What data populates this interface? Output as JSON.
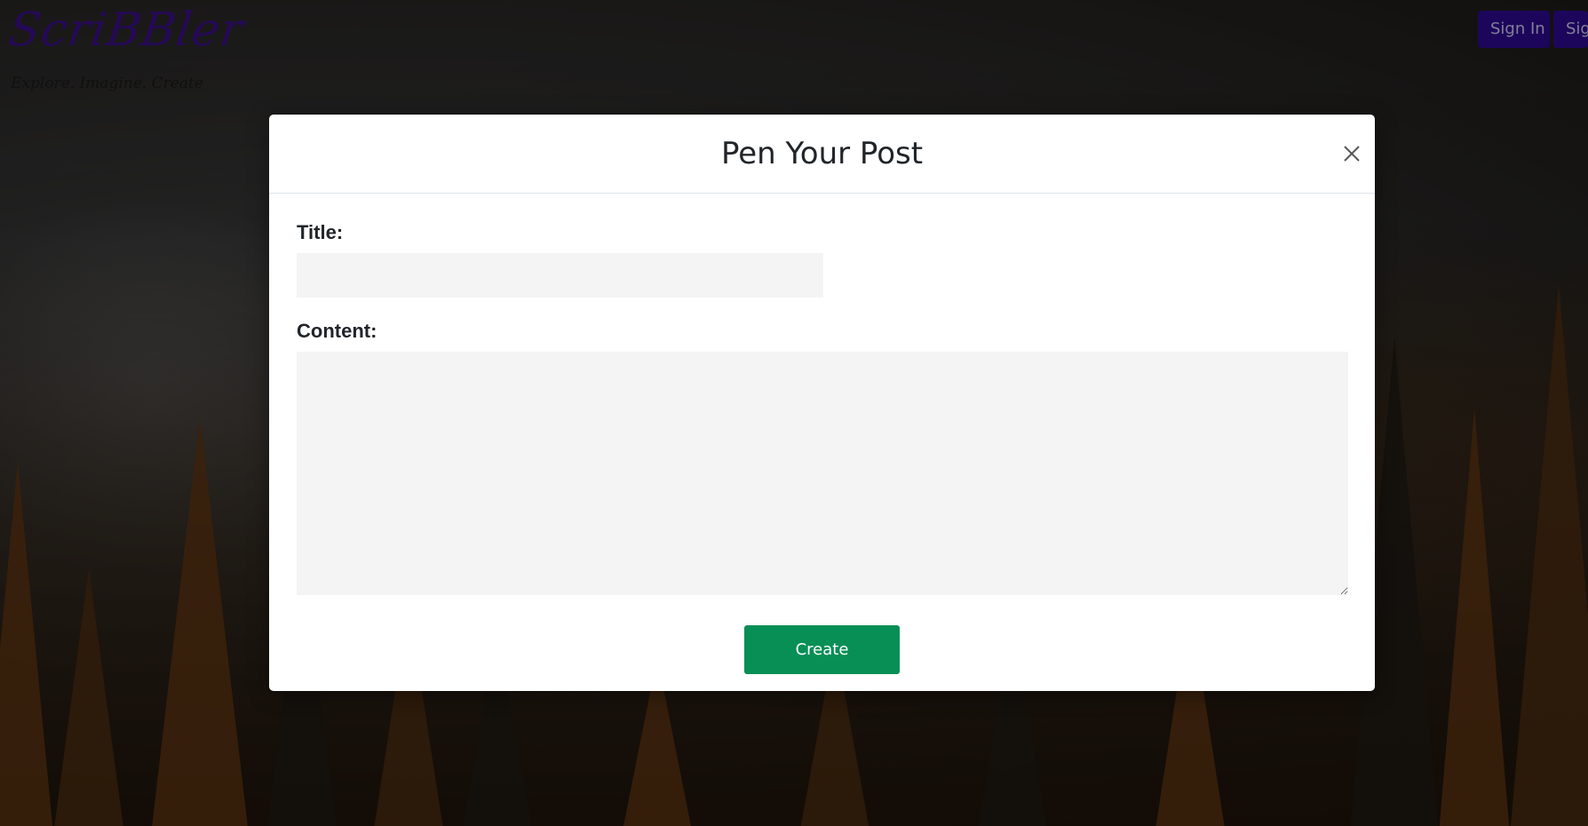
{
  "header": {
    "logo_text": "ScriBBler",
    "tagline": "Explore. Imagine. Create",
    "signin_label": "Sign In",
    "signup_label": "Sign Up"
  },
  "modal": {
    "title": "Pen Your Post",
    "title_field_label": "Title:",
    "title_field_value": "",
    "content_field_label": "Content:",
    "content_field_value": "",
    "create_label": "Create"
  },
  "colors": {
    "brand": "#3a0f86",
    "nav_button": "#2b0a8c",
    "create_button": "#078f55",
    "input_bg": "#f4f4f4"
  },
  "icons": {
    "close": "close-icon"
  }
}
